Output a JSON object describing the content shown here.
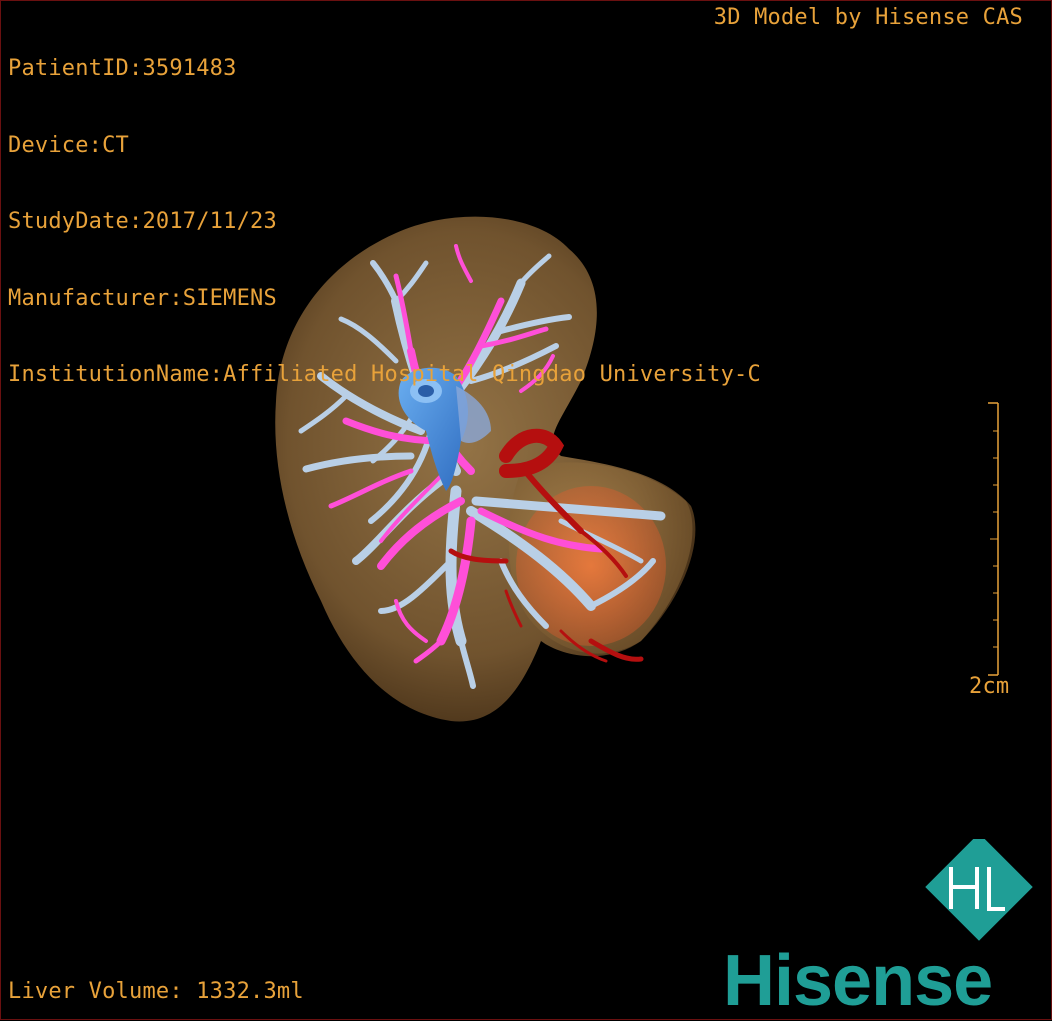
{
  "header": {
    "patient_id": "PatientID:3591483",
    "device": "Device:CT",
    "study_date": "StudyDate:2017/11/23",
    "manufacturer": "Manufacturer:SIEMENS",
    "institution": "InstitutionName:Affiliated Hospital Qingdao University-C"
  },
  "credit": "3D Model by Hisense CAS",
  "footer": {
    "liver_volume": "Liver Volume: 1332.3ml"
  },
  "scale": {
    "label": "2cm"
  },
  "brand": {
    "name": "Hisense",
    "mark": "HL"
  },
  "model": {
    "structures": [
      "liver-surface",
      "portal-vein",
      "hepatic-vein",
      "inferior-vena-cava",
      "hepatic-artery",
      "tumor"
    ]
  },
  "colors": {
    "overlay_text": "#e8a23a",
    "liver": "#8a6a3e",
    "portal_vein": "#ff4fd8",
    "hepatic_vein": "#b9cfe6",
    "vena_cava": "#3f86d6",
    "artery": "#b50f0f",
    "tumor": "#e8622e",
    "brand": "#1f9e96"
  }
}
